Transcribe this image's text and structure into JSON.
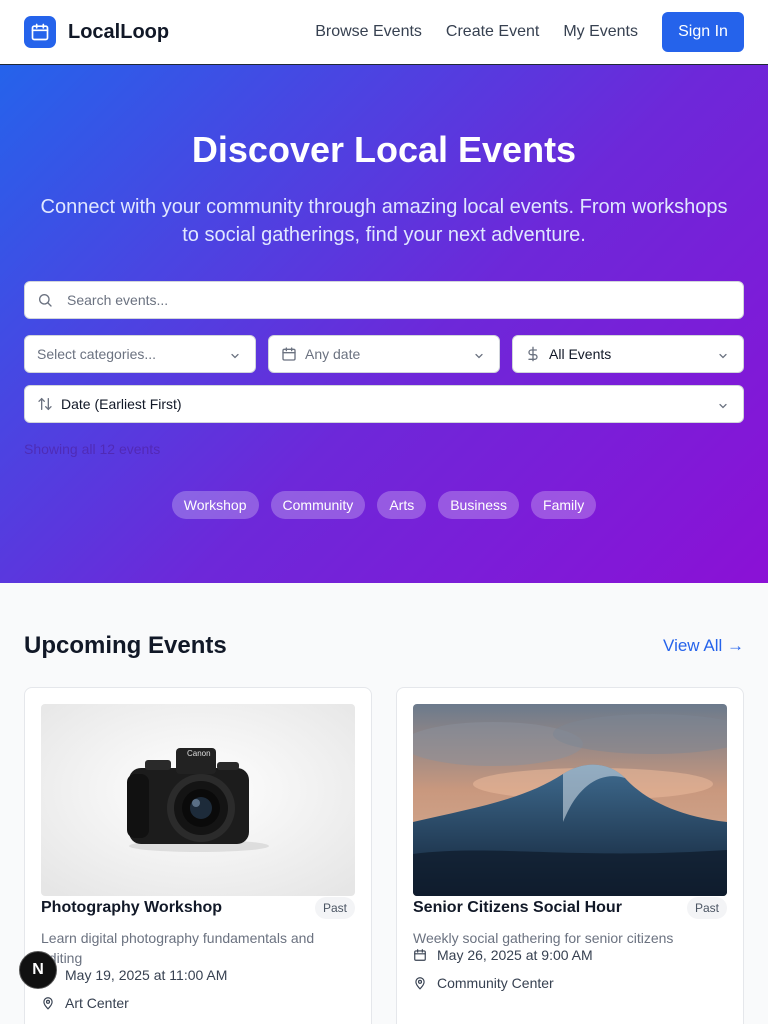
{
  "header": {
    "brand": "LocalLoop",
    "nav": [
      "Browse Events",
      "Create Event",
      "My Events"
    ],
    "sign_in": "Sign In"
  },
  "hero": {
    "title": "Discover Local Events",
    "subtitle": "Connect with your community through amazing local events. From workshops to social gatherings, find your next adventure.",
    "search_placeholder": "Search events...",
    "category_placeholder": "Select categories...",
    "date_placeholder": "Any date",
    "price_value": "All Events",
    "sort_value": "Date (Earliest First)",
    "showing": "Showing all 12 events",
    "chips": [
      "Workshop",
      "Community",
      "Arts",
      "Business",
      "Family"
    ]
  },
  "section": {
    "title": "Upcoming Events",
    "view_all": "View All →"
  },
  "events": [
    {
      "title": "Photography Workshop",
      "badge": "Past",
      "description": "Learn digital photography fundamentals and editing",
      "date": "May 19, 2025 at 11:00 AM",
      "location": "Art Center"
    },
    {
      "title": "Senior Citizens Social Hour",
      "badge": "Past",
      "description": "Weekly social gathering for senior citizens",
      "date": "May 26, 2025 at 9:00 AM",
      "location": "Community Center"
    }
  ],
  "dev_badge": "N",
  "colors": {
    "accent": "#2563eb",
    "hero_start": "#2563eb",
    "hero_end": "#8b11d6"
  }
}
